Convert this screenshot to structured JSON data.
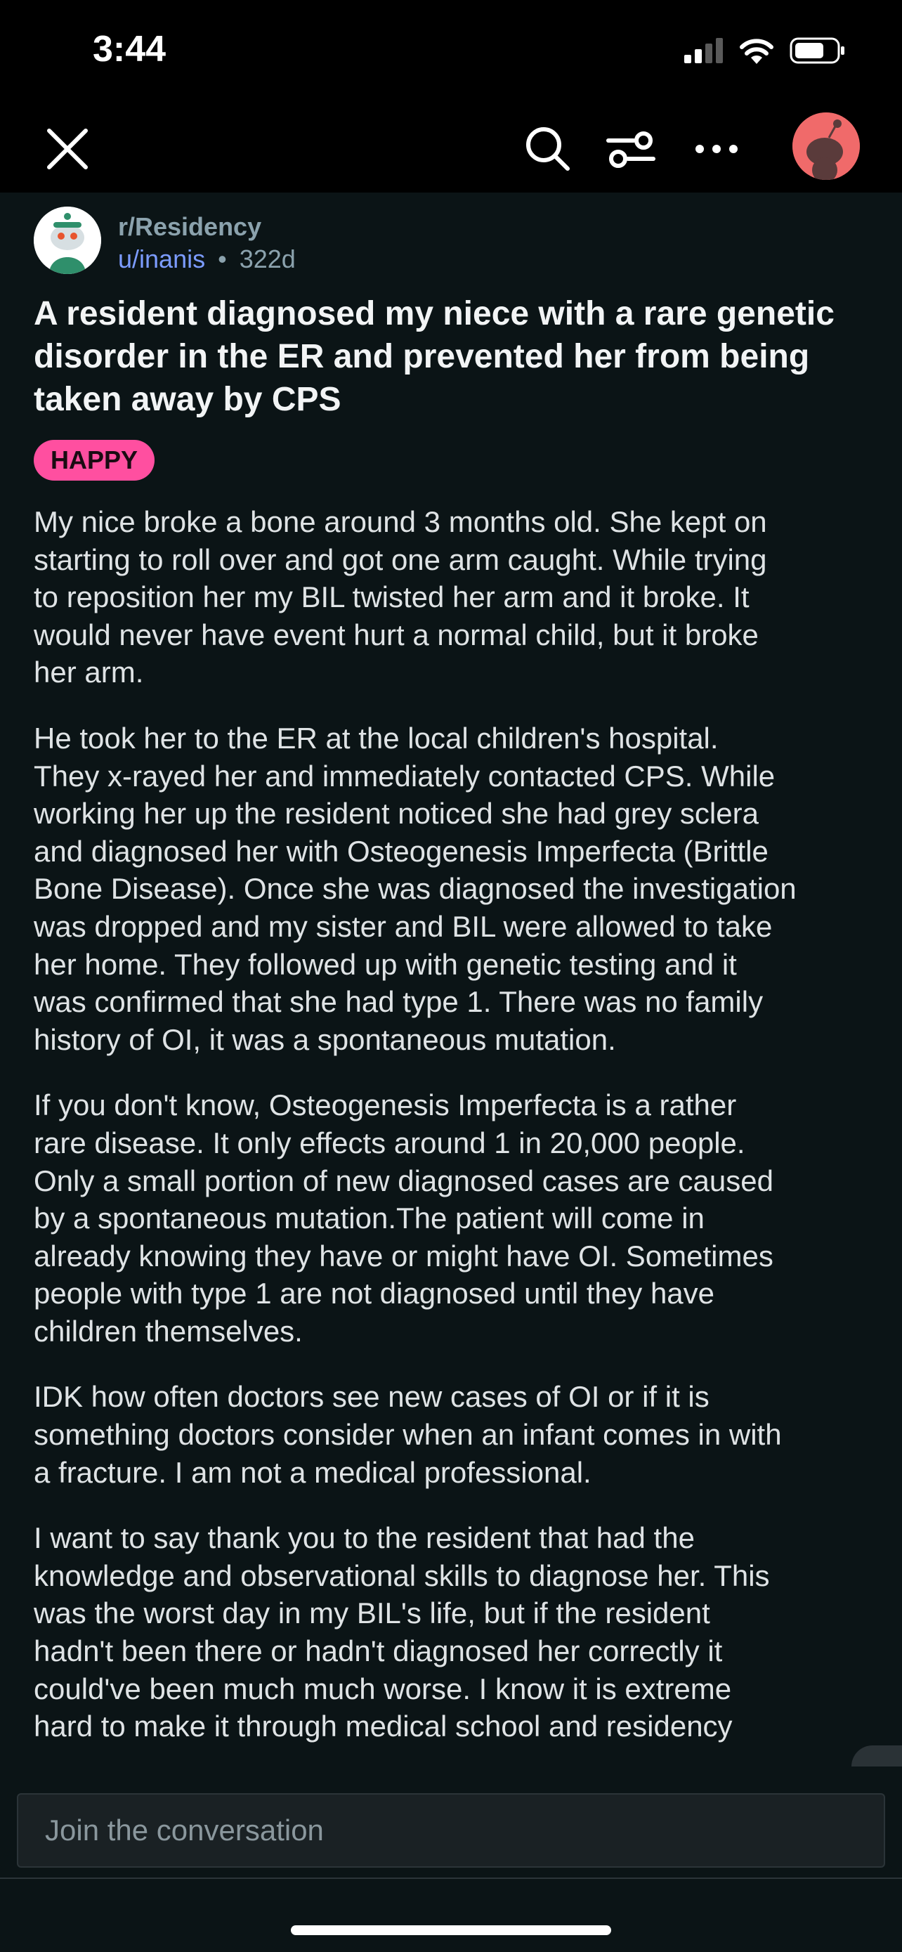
{
  "status_bar": {
    "time": "3:44"
  },
  "post": {
    "subreddit": "r/Residency",
    "author": "u/inanis",
    "separator": "•",
    "age": "322d",
    "title": "A resident diagnosed my niece with a rare genetic disorder in the ER and prevented her from being taken away by CPS",
    "flair": "HAPPY",
    "paragraphs": [
      "My nice broke a bone around 3 months old. She kept on\nstarting to roll over and got one arm caught. While trying\nto reposition her my BIL twisted her arm and it broke. It\nwould never have event hurt a normal child, but it broke\nher arm.",
      "He took her to the ER at the local children's hospital.\nThey x-rayed her and immediately contacted CPS. While\nworking her up the resident noticed she had grey sclera\nand diagnosed her with Osteogenesis Imperfecta (Brittle\nBone Disease). Once she was diagnosed the investigation\nwas dropped and my sister and BIL were allowed to take\nher home. They followed up with genetic testing and it\nwas confirmed that she had type 1. There was no family\nhistory of OI, it was a spontaneous mutation.",
      "If you don't know, Osteogenesis Imperfecta is a rather\nrare disease. It only effects around 1 in 20,000 people.\nOnly a small portion of new diagnosed cases are caused\nby a spontaneous mutation.The patient will come in\nalready knowing they have or might have OI. Sometimes\npeople with type 1 are not diagnosed until they have\nchildren themselves.",
      "IDK how often doctors see new cases of OI or if it is\nsomething doctors consider when an infant comes in with\na fracture. I am not a medical professional.",
      "I want to say thank you to the resident that had the\nknowledge and observational skills to diagnose her. This\nwas the worst day in my BIL's life, but if the resident\nhadn't been there or hadn't diagnosed her correctly it\ncould've been much much worse. I know it is extreme\nhard to make it through medical school and residency"
    ]
  },
  "composer": {
    "placeholder": "Join the conversation"
  },
  "colors": {
    "background": "#0b1416",
    "flair": "#ff4fa0",
    "author_link": "#7c9cff",
    "avatar": "#f06a6a"
  },
  "icons": [
    "close-icon",
    "search-icon",
    "sort-icon",
    "more-icon",
    "user-avatar",
    "chevron-left-icon",
    "chevron-down-icon"
  ]
}
